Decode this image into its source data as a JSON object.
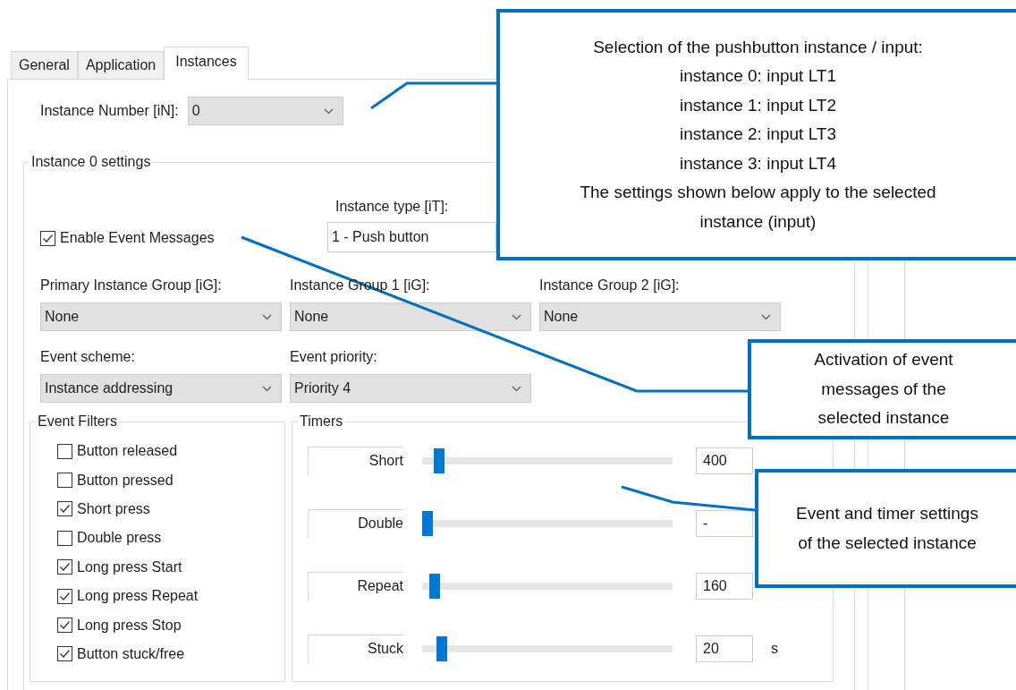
{
  "tabs": [
    {
      "label": "General",
      "selected": false
    },
    {
      "label": "Application",
      "selected": false
    },
    {
      "label": "Instances",
      "selected": true
    }
  ],
  "instance_number": {
    "label": "Instance Number [iN]:",
    "value": "0"
  },
  "settings_group": {
    "title": "Instance 0 settings",
    "enable_event_messages": {
      "label": "Enable Event Messages",
      "checked": true
    },
    "instance_type": {
      "label": "Instance type [iT]:",
      "value": "1 - Push button"
    },
    "groups": [
      {
        "label": "Primary Instance Group [iG]:",
        "value": "None"
      },
      {
        "label": "Instance Group 1 [iG]:",
        "value": "None"
      },
      {
        "label": "Instance Group 2 [iG]:",
        "value": "None"
      }
    ],
    "event_scheme": {
      "label": "Event scheme:",
      "value": "Instance addressing"
    },
    "event_priority": {
      "label": "Event priority:",
      "value": "Priority 4"
    },
    "event_filters": {
      "title": "Event Filters",
      "items": [
        {
          "label": "Button released",
          "checked": false
        },
        {
          "label": "Button pressed",
          "checked": false
        },
        {
          "label": "Short press",
          "checked": true
        },
        {
          "label": "Double press",
          "checked": false
        },
        {
          "label": "Long press Start",
          "checked": true
        },
        {
          "label": "Long press Repeat",
          "checked": true
        },
        {
          "label": "Long press Stop",
          "checked": true
        },
        {
          "label": "Button stuck/free",
          "checked": true
        }
      ]
    },
    "timers": {
      "title": "Timers",
      "rows": [
        {
          "label": "Short",
          "level": 0.05,
          "value": "400"
        },
        {
          "label": "Double",
          "level": 0,
          "value": "-"
        },
        {
          "label": "Repeat",
          "level": 0.03,
          "value": "160"
        },
        {
          "label": "Stuck",
          "level": 0.06,
          "value": "20",
          "unit": "s"
        }
      ]
    }
  },
  "callouts": [
    {
      "text": "Selection of the pushbutton instance / input:\ninstance 0: input LT1\ninstance 1: input LT2\ninstance 2: input LT3\ninstance 3: input LT4\nThe settings shown below apply to the selected\ninstance (input)"
    },
    {
      "text": "Activation of event\nmessages of the\nselected instance"
    },
    {
      "text": "Event and timer settings\nof the selected instance"
    }
  ]
}
